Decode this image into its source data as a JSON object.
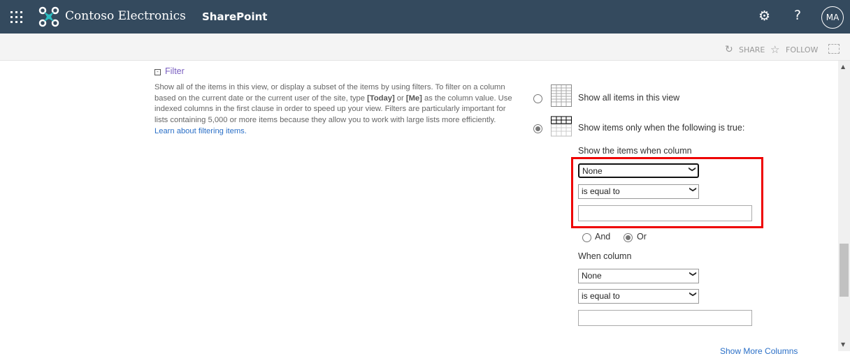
{
  "header": {
    "brand": "Contoso Electronics",
    "app": "SharePoint",
    "avatar": "MA"
  },
  "actions": {
    "share": "SHARE",
    "follow": "FOLLOW"
  },
  "filter": {
    "title": "Filter",
    "desc1": "Show all of the items in this view, or display a subset of the items by using filters. To filter on a column based on the current date or the current user of the site, type ",
    "today": "[Today]",
    "or": " or ",
    "me": "[Me]",
    "desc2": " as the column value. Use indexed columns in the first clause in order to speed up your view. Filters are particularly important for lists containing 5,000 or more items because they allow you to work with large lists more efficiently. ",
    "link": "Learn about filtering items."
  },
  "options": {
    "all": "Show all items in this view",
    "conditional": "Show items only when the following is true:"
  },
  "clause1": {
    "label": "Show the items when column",
    "column": "None",
    "operator": "is equal to",
    "value": ""
  },
  "logic": {
    "and": "And",
    "or": "Or"
  },
  "clause2": {
    "label": "When column",
    "column": "None",
    "operator": "is equal to",
    "value": ""
  },
  "more": "Show More Columns"
}
